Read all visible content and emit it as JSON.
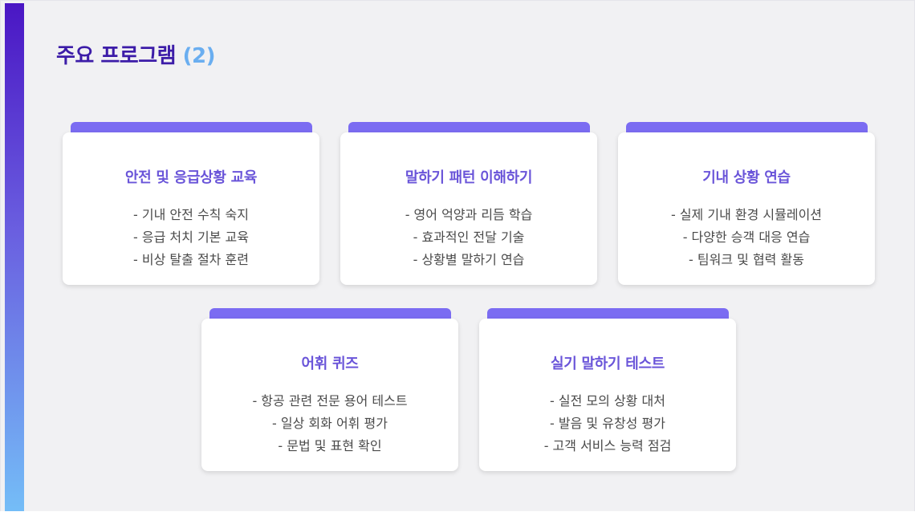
{
  "slide": {
    "title_main": "주요 프로그램",
    "title_suffix": "(2)"
  },
  "colors": {
    "accent_bar_top": "#4a16c4",
    "accent_bar_bottom": "#74bdf7",
    "title_main": "#3c1ca8",
    "title_suffix": "#6aaef0",
    "card_tab": "#7b6cf2",
    "card_title": "#6a55d9",
    "card_text": "#4a4a4a",
    "background": "#f1f1f3"
  },
  "cards": [
    {
      "title": "안전 및 응급상황 교육",
      "items": [
        "- 기내 안전 수칙 숙지",
        "- 응급 처치 기본 교육",
        "- 비상 탈출 절차 훈련"
      ]
    },
    {
      "title": "말하기 패턴 이해하기",
      "items": [
        "- 영어 억양과 리듬 학습",
        "- 효과적인 전달 기술",
        "- 상황별 말하기 연습"
      ]
    },
    {
      "title": "기내 상황 연습",
      "items": [
        "- 실제 기내 환경 시뮬레이션",
        "- 다양한 승객 대응 연습",
        "- 팀워크 및 협력 활동"
      ]
    },
    {
      "title": "어휘 퀴즈",
      "items": [
        "- 항공 관련 전문 용어 테스트",
        "- 일상 회화 어휘 평가",
        "- 문법 및 표현 확인"
      ]
    },
    {
      "title": "실기 말하기 테스트",
      "items": [
        "- 실전 모의 상황 대처",
        "- 발음 및 유창성 평가",
        "- 고객 서비스 능력 점검"
      ]
    }
  ]
}
